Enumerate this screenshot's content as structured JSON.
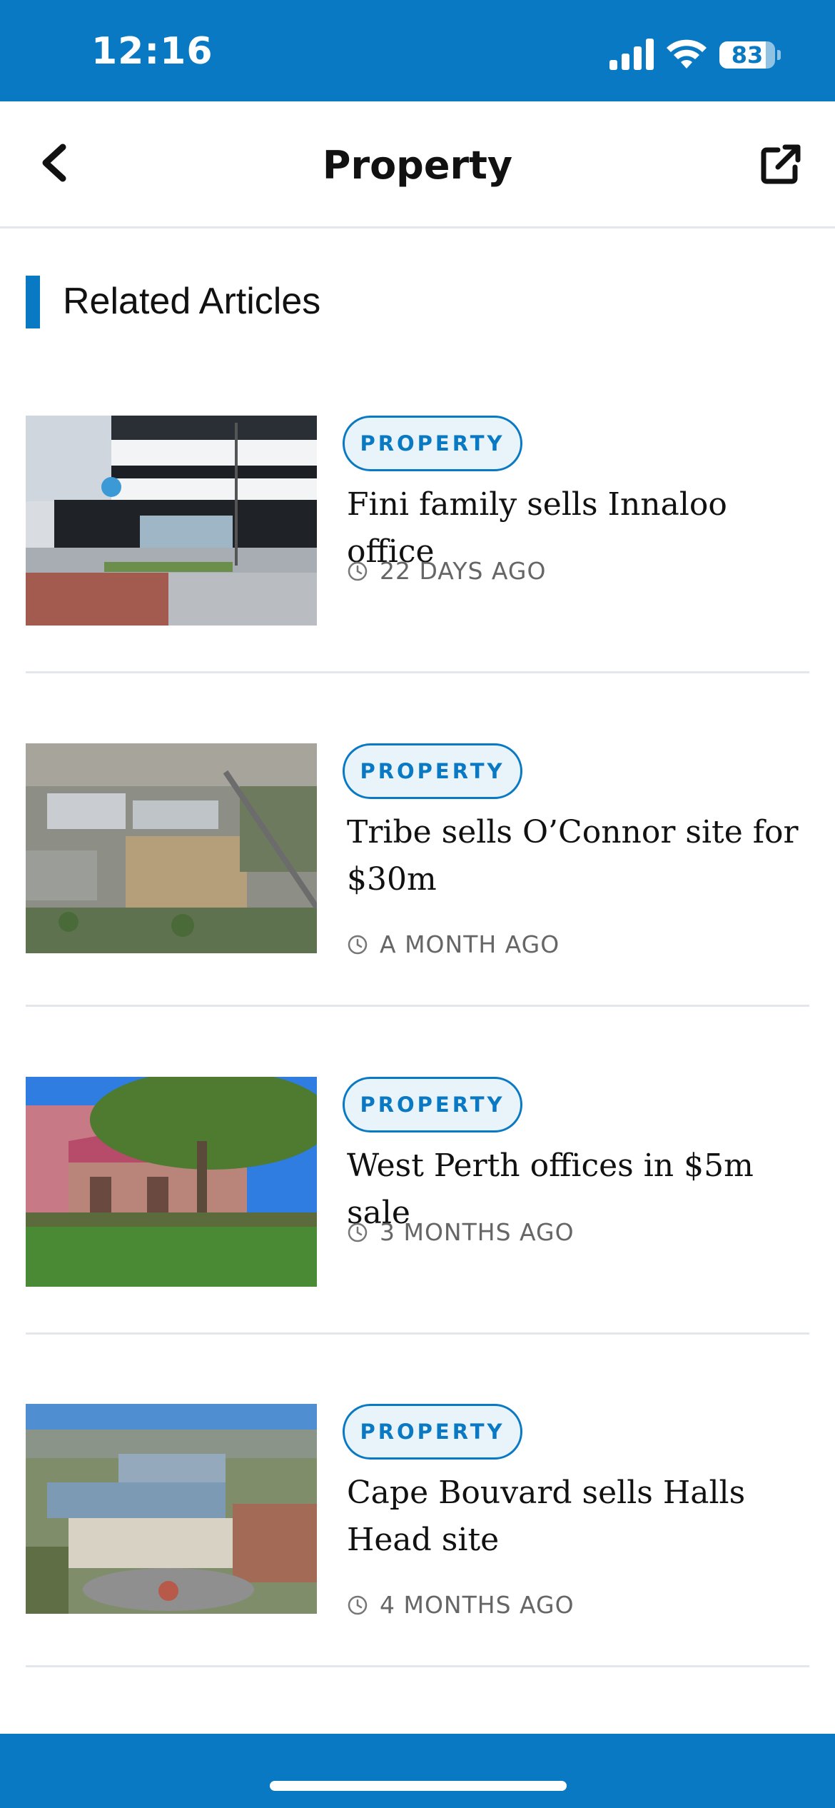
{
  "status_bar": {
    "time": "12:16",
    "battery_percent": "83",
    "battery_level": 0.83,
    "signal_icon": "cellular-signal-icon",
    "wifi_icon": "wifi-icon"
  },
  "nav": {
    "title": "Property",
    "back_icon": "chevron-left-icon",
    "share_icon": "external-link-icon"
  },
  "section": {
    "title": "Related Articles"
  },
  "articles": [
    {
      "tag": "PROPERTY",
      "title": "Fini family sells Innaloo office",
      "time": "22 DAYS AGO"
    },
    {
      "tag": "PROPERTY",
      "title": "Tribe sells O’Connor site for $30m",
      "time": "A MONTH AGO"
    },
    {
      "tag": "PROPERTY",
      "title": "West Perth offices in $5m sale",
      "time": "3 MONTHS AGO"
    },
    {
      "tag": "PROPERTY",
      "title": "Cape Bouvard sells Halls Head site",
      "time": "4 MONTHS AGO"
    }
  ],
  "colors": {
    "brand_blue": "#0a79c4",
    "tag_background": "#e9f3fa",
    "divider": "#e3e6ea",
    "meta_text": "#666666"
  }
}
